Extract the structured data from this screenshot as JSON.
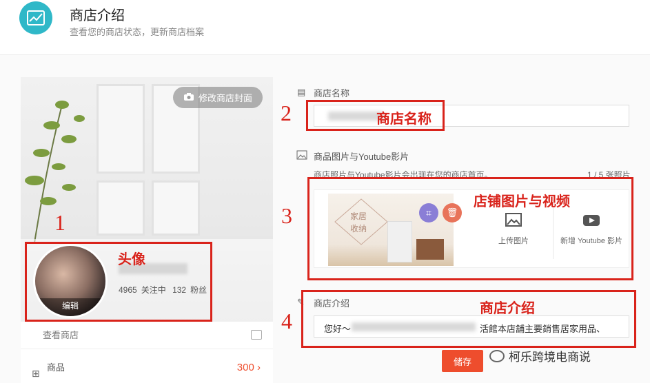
{
  "header": {
    "title": "商店介绍",
    "subtitle": "查看您的商店状态，更新商店档案"
  },
  "left": {
    "cover_button": "修改商店封面",
    "avatar_edit": "编辑",
    "stats": {
      "following_count": "4965",
      "following_label": "关注中",
      "followers_count": "132",
      "followers_label": "粉丝"
    },
    "view_shop": "查看商店",
    "products_label": "商品",
    "products_count": "300",
    "products_arrow": "›"
  },
  "right": {
    "shop_name_label": "商店名称",
    "media_label": "商品图片与Youtube影片",
    "media_hint": "商店照片与Youtube影片会出现在您的商店首页。",
    "media_count": "1 / 5 张照片",
    "thumb_text_line1": "家居",
    "thumb_text_line2": "收纳",
    "upload_image": "上传图片",
    "add_youtube": "新增 Youtube 影片",
    "intro_label": "商店介绍",
    "intro_prefix": "您好～",
    "intro_suffix": "活館本店舖主要銷售居家用品、",
    "save_button": "储存"
  },
  "annotations": [
    {
      "number": "1",
      "label": "头像"
    },
    {
      "number": "2",
      "label": "商店名称"
    },
    {
      "number": "3",
      "label": "店铺图片与视频"
    },
    {
      "number": "4",
      "label": "商店介绍"
    }
  ],
  "watermark": "柯乐跨境电商说",
  "colors": {
    "accent": "#ee4d2d",
    "annotation": "#d9231b",
    "header_icon": "#2fb8c8"
  }
}
